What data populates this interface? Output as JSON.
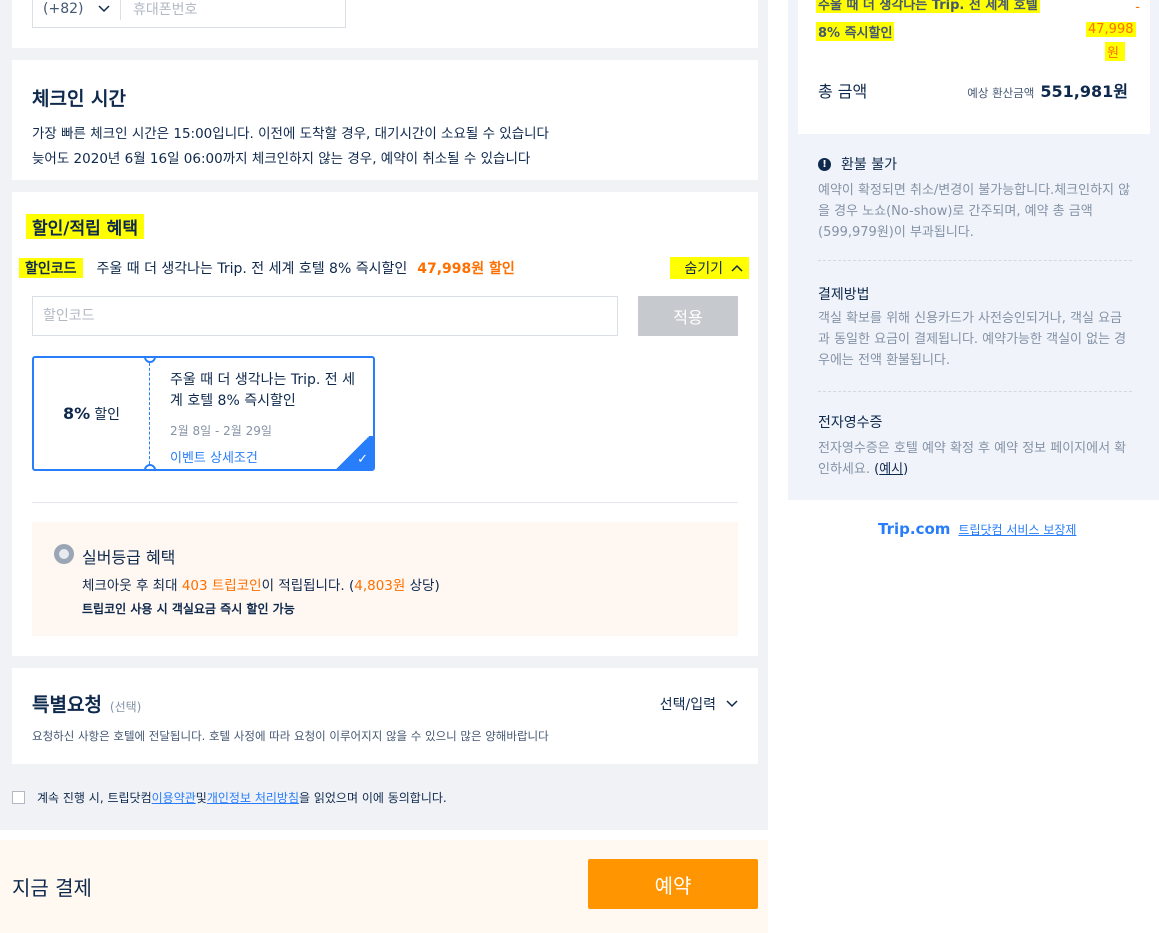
{
  "contact": {
    "country_code": "(+82)",
    "phone_placeholder": "휴대폰번호"
  },
  "checkin": {
    "title": "체크인 시간",
    "line1": "가장 빠른 체크인 시간은 15:00입니다. 이전에 도착할 경우, 대기시간이 소요될 수 있습니다",
    "line2": "늦어도 2020년 6월 16일 06:00까지 체크인하지 않는 경우, 예약이 취소될 수 있습니다"
  },
  "discount": {
    "title": "할인/적립 혜택",
    "code_label": "할인코드",
    "code_desc": "주울 때 더 생각나는 Trip. 전 세계 호텔 8% 즉시할인",
    "code_amount": "47,998원 할인",
    "toggle_label": "숨기기",
    "input_placeholder": "할인코드",
    "apply_label": "적용",
    "coupon": {
      "percent": "8%",
      "percent_suffix": "할인",
      "title": "주울 때 더 생각나는 Trip. 전 세계 호텔 8% 즉시할인",
      "date_range": "2월 8일 - 2월 29일",
      "detail_link": "이벤트 상세조건"
    },
    "silver": {
      "title": "실버등급 혜택",
      "line1_prefix": "체크아웃 후 최대 ",
      "line1_coins": "403 트립코인",
      "line1_mid": "이 적립됩니다. (",
      "line1_value": "4,803원",
      "line1_suffix": " 상당)",
      "line2": "트립코인 사용 시 객실요금 즉시 할인 가능"
    }
  },
  "special": {
    "title": "특별요청",
    "optional": "(선택)",
    "select_label": "선택/입력",
    "desc": "요청하신 사항은 호텔에 전달됩니다. 호텔 사정에 따라 요청이 이루어지지 않을 수 있으니 많은 양해바랍니다"
  },
  "agreement": {
    "prefix": "계속 진행 시, 트립닷컴 ",
    "terms_link": "이용약관",
    "and": " 및 ",
    "privacy_link": "개인정보 처리방침",
    "suffix": "을 읽었으며 이에 동의합니다."
  },
  "payment": {
    "label": "지금 결제",
    "book_label": "예약"
  },
  "summary": {
    "promo_line1": "주울 때 더 생각나는 Trip. 전 세계 호텔",
    "promo_line2": "8% 즉시할인",
    "promo_minus": "-",
    "promo_amount": "47,998",
    "promo_currency": "원",
    "total_label": "총 금액",
    "total_sub": "예상 환산금액",
    "total_amount": "551,981원"
  },
  "refund": {
    "title": "환불 불가",
    "body": "예약이 확정되면 취소/변경이 불가능합니다.체크인하지 않을 경우 노쇼(No-show)로 간주되며, 예약 총 금액(599,979원)이 부과됩니다."
  },
  "payment_method": {
    "title": "결제방법",
    "body": "객실 확보를 위해 신용카드가 사전승인되거나, 객실 요금과 동일한 요금이 결제됩니다. 예약가능한 객실이 없는 경우에는 전액 환불됩니다."
  },
  "receipt": {
    "title": "전자영수증",
    "body": "전자영수증은 호텔 예약 확정 후 예약 정보 페이지에서 확인하세요. ",
    "example_open": "(",
    "example_link": "예시",
    "example_close": ")"
  },
  "footer": {
    "logo_main": "Trip",
    "logo_suffix": ".com",
    "guarantee": "트립닷컴 서비스 보장제"
  },
  "colors": {
    "accent_blue": "#287dfa",
    "accent_orange": "#ff6f00",
    "book_button": "#ff9500",
    "highlight": "#ffff00"
  }
}
